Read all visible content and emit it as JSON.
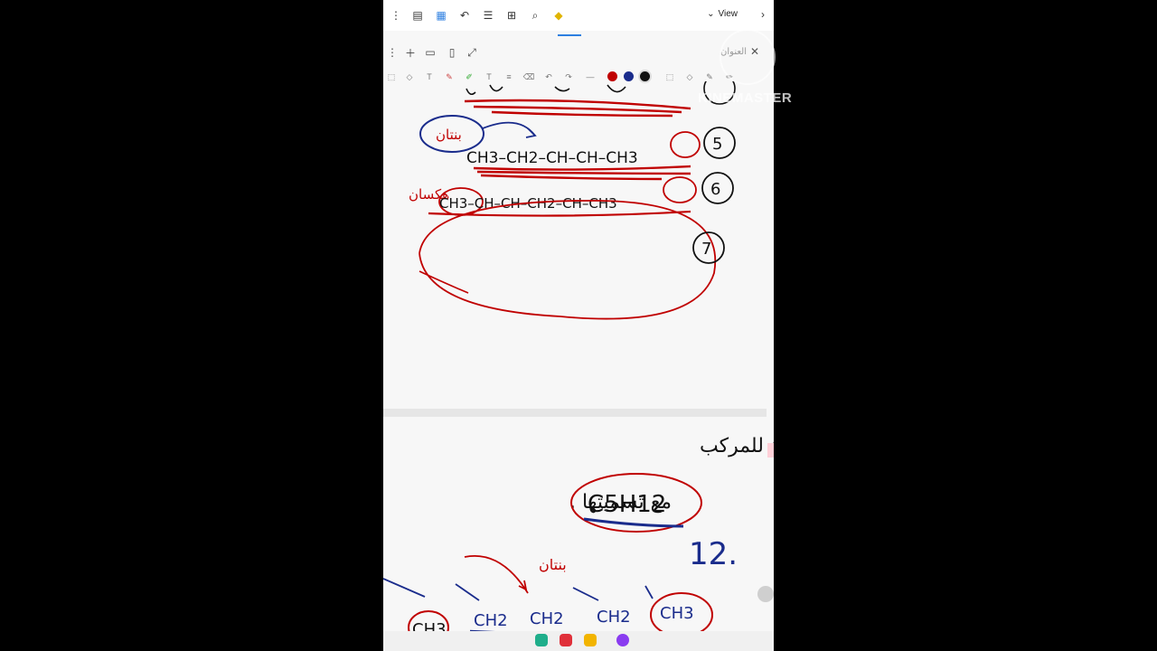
{
  "toolbar": {
    "view_label": "View",
    "title_placeholder": "العنوان"
  },
  "pen_colors": [
    "#c00000",
    "#1a2c8c",
    "#111111"
  ],
  "watermark": "KINEMASTER",
  "note_top": {
    "labels": [
      "5",
      "6",
      "7"
    ],
    "formula_5": "CH3–CH2–CH–CH–CH3",
    "formula_6": "CH3–CH–CH–CH2–CH–CH3",
    "arabic_a": "بنتان",
    "arabic_b": "هكسان"
  },
  "note_bottom": {
    "question_line1": "اكتب الصيغ البنائية للمركب",
    "question_line2": "مع تسميتها .",
    "compound": "C5H12",
    "count_note": "12.",
    "arabic_c": "بنتان",
    "chain": [
      "CH3",
      "CH2",
      "CH2",
      "CH2",
      "CH3"
    ]
  }
}
